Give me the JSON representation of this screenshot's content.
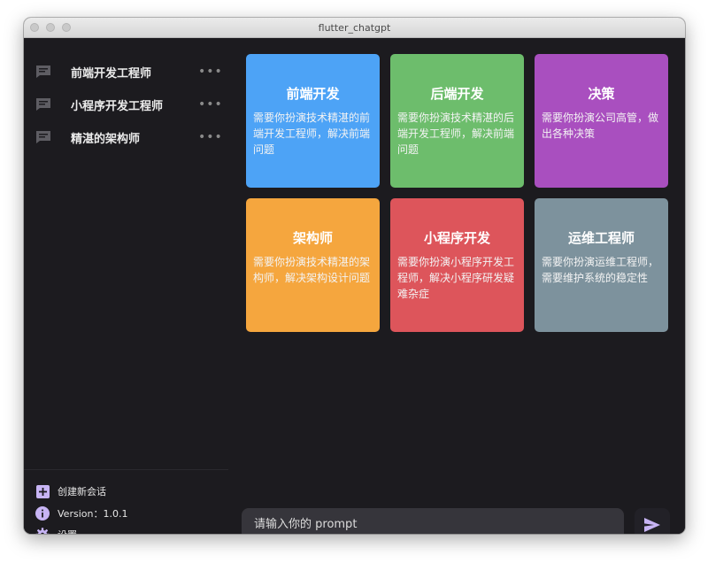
{
  "window": {
    "title": "flutter_chatgpt"
  },
  "sidebar": {
    "conversations": [
      {
        "label": "前端开发工程师"
      },
      {
        "label": "小程序开发工程师"
      },
      {
        "label": "精湛的架构师"
      }
    ],
    "more_glyph": "•••",
    "actions": {
      "new_chat": "创建新会话",
      "version": "Version：1.0.1",
      "settings": "设置"
    }
  },
  "cards": [
    {
      "title": "前端开发",
      "desc": "需要你扮演技术精湛的前端开发工程师，解决前端问题",
      "color": "#4da3f6"
    },
    {
      "title": "后端开发",
      "desc": "需要你扮演技术精湛的后端开发工程师，解决前端问题",
      "color": "#6dbd6c"
    },
    {
      "title": "决策",
      "desc": "需要你扮演公司高管，做出各种决策",
      "color": "#a94fbf"
    },
    {
      "title": "架构师",
      "desc": "需要你扮演技术精湛的架构师，解决架构设计问题",
      "color": "#f5a63e"
    },
    {
      "title": "小程序开发",
      "desc": "需要你扮演小程序开发工程师，解决小程序研发疑难杂症",
      "color": "#dd555b"
    },
    {
      "title": "运维工程师",
      "desc": "需要你扮演运维工程师，需要维护系统的稳定性",
      "color": "#7d929d"
    }
  ],
  "input": {
    "placeholder": "请输入你的 prompt",
    "value": ""
  },
  "colors": {
    "accent": "#c7b4f4",
    "background": "#1c1b1f"
  }
}
